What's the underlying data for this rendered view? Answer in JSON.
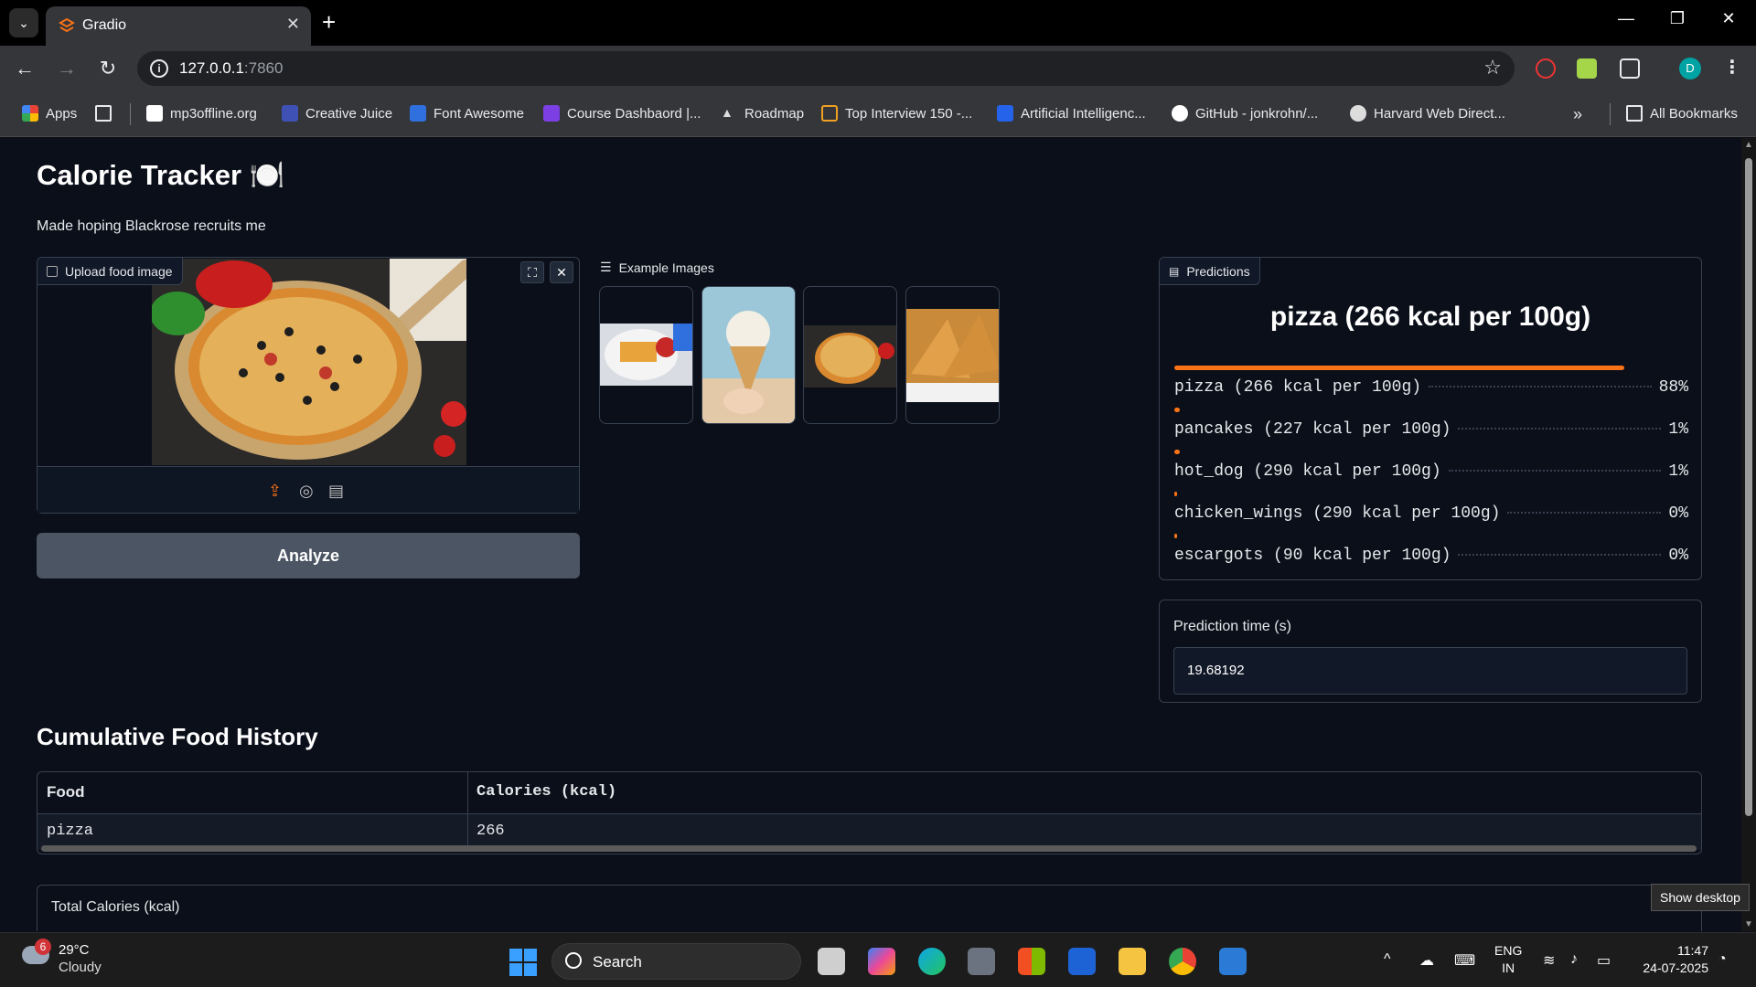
{
  "browser": {
    "tab_title": "Gradio",
    "url_host": "127.0.0.1",
    "url_port": ":7860",
    "bookmarks": [
      {
        "label": "Apps",
        "color": "#ea4335"
      },
      {
        "label": "mp3offline.org",
        "color": "#ffffff"
      },
      {
        "label": "Creative Juice",
        "color": "#3f51b5"
      },
      {
        "label": "Font Awesome",
        "color": "#2f6fde"
      },
      {
        "label": "Course Dashbaord |...",
        "color": "#7b3fe4"
      },
      {
        "label": "Roadmap",
        "color": "#bbbbbb"
      },
      {
        "label": "Top Interview 150 -...",
        "color": "#f0a020"
      },
      {
        "label": "Artificial Intelligenc...",
        "color": "#2563eb"
      },
      {
        "label": "GitHub - jonkrohn/...",
        "color": "#ffffff"
      },
      {
        "label": "Harvard Web Direct...",
        "color": "#dddddd"
      }
    ],
    "all_bookmarks": "All Bookmarks",
    "profile_initial": "D"
  },
  "app": {
    "title": "Calorie Tracker 🍽️",
    "subtitle": "Made hoping Blackrose recruits me",
    "upload_label": "Upload food image",
    "examples_label": "Example Images",
    "analyze_label": "Analyze",
    "predictions_label": "Predictions",
    "top_prediction": "pizza (266 kcal per 100g)",
    "predictions": [
      {
        "label": "pizza (266 kcal per 100g)",
        "pct_text": "88%",
        "value": 0.88
      },
      {
        "label": "pancakes (227 kcal per 100g)",
        "pct_text": "1%",
        "value": 0.01
      },
      {
        "label": "hot_dog (290 kcal per 100g)",
        "pct_text": "1%",
        "value": 0.01
      },
      {
        "label": "chicken_wings (290 kcal per 100g)",
        "pct_text": "0%",
        "value": 0.004
      },
      {
        "label": "escargots (90 kcal per 100g)",
        "pct_text": "0%",
        "value": 0.003
      }
    ],
    "prediction_time_label": "Prediction time (s)",
    "prediction_time_value": "19.68192",
    "history_title": "Cumulative Food History",
    "history_headers": [
      "Food",
      "Calories (kcal)"
    ],
    "history_rows": [
      [
        "pizza",
        "266"
      ]
    ],
    "total_label": "Total Calories (kcal)",
    "tooltip": "Show desktop",
    "accent_color": "#f97316"
  },
  "taskbar": {
    "weather_badge": "6",
    "weather_temp": "29°C",
    "weather_cond": "Cloudy",
    "search_label": "Search",
    "lang_top": "ENG",
    "lang_bottom": "IN",
    "time": "11:47",
    "date": "24-07-2025"
  }
}
